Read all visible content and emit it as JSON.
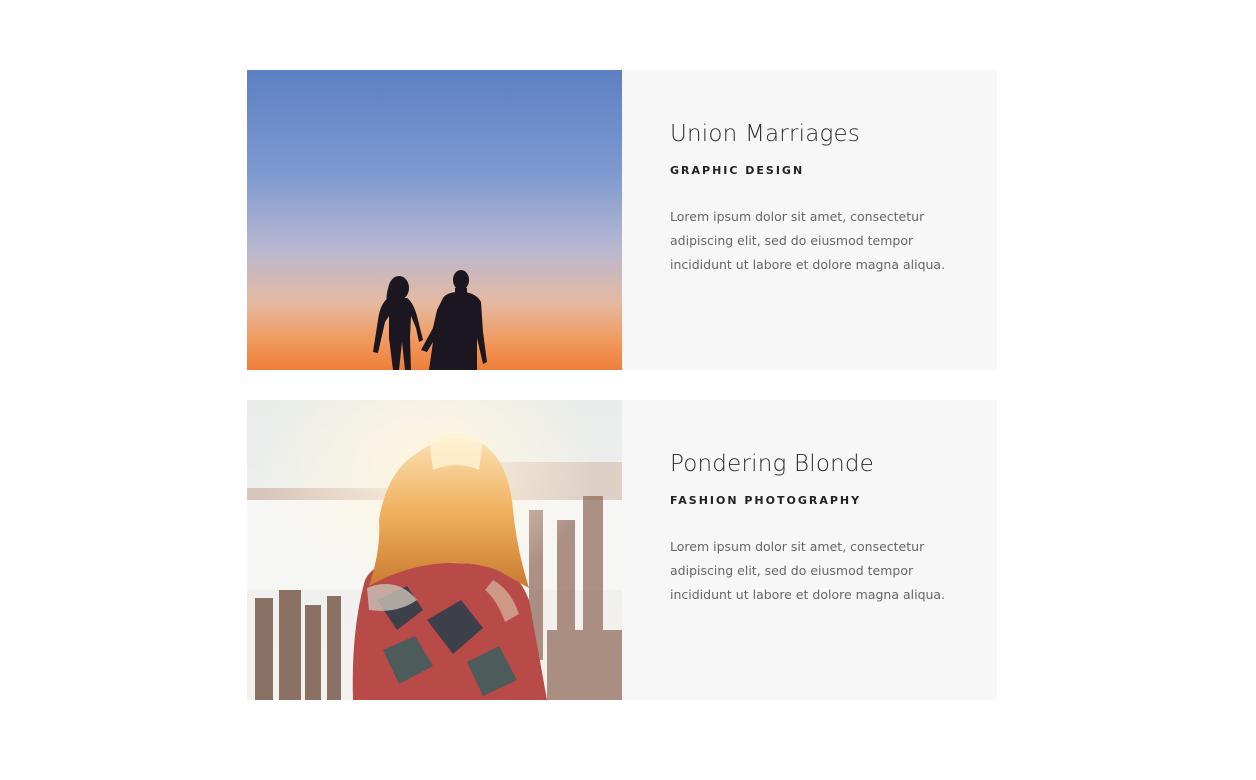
{
  "portfolio": {
    "items": [
      {
        "title": "Union Marriages",
        "category": "GRAPHIC DESIGN",
        "description": "Lorem ipsum dolor sit amet, consectetur adipiscing elit, sed do eiusmod tempor incididunt ut labore et dolore magna aliqua.",
        "image": "couple-silhouette-sunset-photo"
      },
      {
        "title": "Pondering Blonde",
        "category": "FASHION PHOTOGRAPHY",
        "description": "Lorem ipsum dolor sit amet, consectetur adipiscing elit, sed do eiusmod tempor incididunt ut labore et dolore magna aliqua.",
        "image": "blonde-woman-blanket-photo"
      }
    ]
  },
  "colors": {
    "card_background": "#f7f7f7",
    "title": "#2b2b2b",
    "body_text": "#666666"
  }
}
